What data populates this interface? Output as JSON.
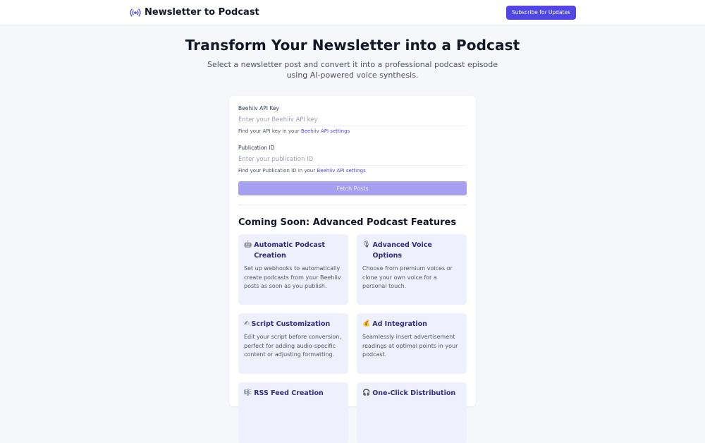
{
  "header": {
    "brand_icon": "broadcast-icon",
    "title": "Newsletter to Podcast",
    "subscribe_label": "Subscribe for Updates",
    "accent": "#4f46e5"
  },
  "hero": {
    "title": "Transform Your Newsletter into a Podcast",
    "subtitle": "Select a newsletter post and convert it into a professional podcast episode using AI-powered voice synthesis."
  },
  "form": {
    "api_key": {
      "label": "Beehiiv API Key",
      "placeholder": "Enter your Beehiiv API key",
      "value": "",
      "help_prefix": "Find your API key in your ",
      "help_link": "Beehiiv API settings"
    },
    "publication_id": {
      "label": "Publication ID",
      "placeholder": "Enter your publication ID",
      "value": "",
      "help_prefix": "Find your Publication ID in your ",
      "help_link": "Beehiiv API settings"
    },
    "fetch_label": "Fetch Posts"
  },
  "features": {
    "title": "Coming Soon: Advanced Podcast Features",
    "items": [
      {
        "icon": "robot-icon",
        "emoji": "🤖",
        "title": "Automatic Podcast Creation",
        "desc": "Set up webhooks to automatically create podcasts from your Beehiiv posts as soon as you publish."
      },
      {
        "icon": "microphone-icon",
        "emoji": "🎙",
        "title": "Advanced Voice Options",
        "desc": "Choose from premium voices or clone your own voice for a personal touch."
      },
      {
        "icon": "pen-icon",
        "emoji": "✍",
        "title": "Script Customization",
        "desc": "Edit your script before conversion, perfect for adding audio-specific content or adjusting formatting."
      },
      {
        "icon": "money-bag-icon",
        "emoji": "💰",
        "title": "Ad Integration",
        "desc": "Seamlessly insert advertisement readings at optimal points in your podcast."
      },
      {
        "icon": "music-note-icon",
        "emoji": "🎼",
        "title": "RSS Feed Creation",
        "desc": ""
      },
      {
        "icon": "headphones-icon",
        "emoji": "🎧",
        "title": "One-Click Distribution",
        "desc": ""
      }
    ]
  }
}
